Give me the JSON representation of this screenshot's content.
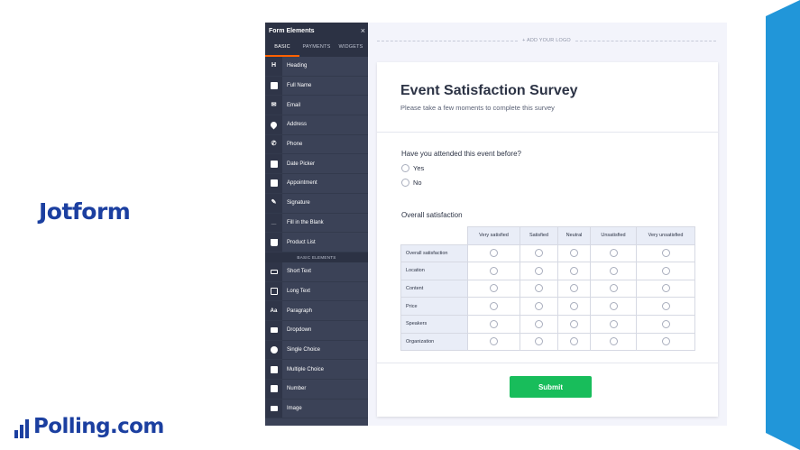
{
  "brand": {
    "jotform": "Jotform",
    "polling": "Polling.com"
  },
  "colors": {
    "accent": "#2196d9",
    "brand_blue": "#1b3fa0",
    "sidebar_bg": "#3b4257",
    "submit_green": "#18bd5b",
    "active_tab": "#ff6100"
  },
  "sidebar": {
    "title": "Form Elements",
    "close_icon": "×",
    "tabs": [
      "BASIC",
      "PAYMENTS",
      "WIDGETS"
    ],
    "items": [
      {
        "label": "Heading",
        "icon": "heading-icon"
      },
      {
        "label": "Full Name",
        "icon": "user-icon"
      },
      {
        "label": "Email",
        "icon": "envelope-icon"
      },
      {
        "label": "Address",
        "icon": "map-pin-icon"
      },
      {
        "label": "Phone",
        "icon": "phone-icon"
      },
      {
        "label": "Date Picker",
        "icon": "calendar-icon"
      },
      {
        "label": "Appointment",
        "icon": "appointment-icon"
      },
      {
        "label": "Signature",
        "icon": "signature-icon"
      },
      {
        "label": "Fill in the Blank",
        "icon": "fill-blank-icon"
      },
      {
        "label": "Product List",
        "icon": "cart-icon"
      }
    ],
    "section_label": "BASIC ELEMENTS",
    "basic_items": [
      {
        "label": "Short Text",
        "icon": "short-text-icon"
      },
      {
        "label": "Long Text",
        "icon": "long-text-icon"
      },
      {
        "label": "Paragraph",
        "icon": "paragraph-icon"
      },
      {
        "label": "Dropdown",
        "icon": "dropdown-icon"
      },
      {
        "label": "Single Choice",
        "icon": "radio-icon"
      },
      {
        "label": "Multiple Choice",
        "icon": "checkbox-icon"
      },
      {
        "label": "Number",
        "icon": "number-icon"
      },
      {
        "label": "Image",
        "icon": "image-icon"
      }
    ]
  },
  "canvas": {
    "logo_placeholder": "+ ADD YOUR LOGO"
  },
  "form": {
    "title": "Event Satisfaction Survey",
    "subtitle": "Please take a few moments to complete this survey",
    "question1": {
      "label": "Have you attended this event before?",
      "options": [
        "Yes",
        "No"
      ]
    },
    "question2": {
      "label": "Overall satisfaction",
      "columns": [
        "Very satisfied",
        "Satisfied",
        "Neutral",
        "Unsatisfied",
        "Very unsatisfied"
      ],
      "rows": [
        "Overall satisfaction",
        "Location",
        "Content",
        "Price",
        "Speakers",
        "Organization"
      ]
    },
    "submit_label": "Submit"
  }
}
